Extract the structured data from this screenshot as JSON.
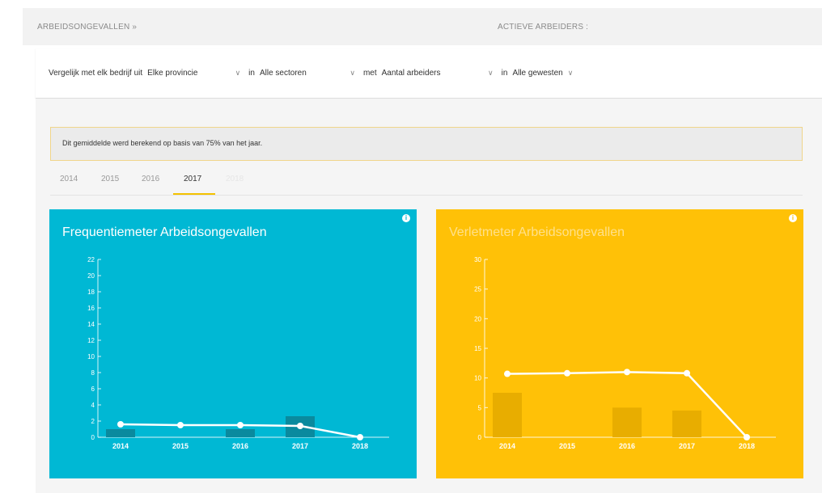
{
  "header": {
    "left_label": "ARBEIDSONGEVALLEN »",
    "right_label": "ACTIEVE ARBEIDERS :"
  },
  "filters": {
    "prefix": "Vergelijk met elk bedrijf uit",
    "province": "Elke provincie",
    "in1": "in",
    "sector": "Alle sectoren",
    "met": "met",
    "workers": "Aantal arbeiders",
    "in2": "in",
    "region": "Alle gewesten"
  },
  "notice": "Dit gemiddelde werd berekend op basis van 75% van het jaar.",
  "tabs": {
    "items": [
      "2014",
      "2015",
      "2016",
      "2017",
      "2018"
    ],
    "active": "2017"
  },
  "colors": {
    "frequency_bg": "#00b8d4",
    "severity_bg": "#ffc107",
    "tab_accent": "#f3c200"
  },
  "chart_data": [
    {
      "type": "line",
      "title": "Frequentiemeter Arbeidsongevallen",
      "categories": [
        "2014",
        "2015",
        "2016",
        "2017",
        "2018"
      ],
      "series": [
        {
          "type": "bar",
          "values": [
            1,
            0,
            1,
            2.6,
            0
          ]
        },
        {
          "type": "line",
          "values": [
            1.6,
            1.5,
            1.5,
            1.4,
            0
          ]
        }
      ],
      "ylim": [
        0,
        22
      ],
      "yticks": [
        0,
        2,
        4,
        6,
        8,
        10,
        12,
        14,
        16,
        18,
        20,
        22
      ]
    },
    {
      "type": "line",
      "title": "Verletmeter Arbeidsongevallen",
      "categories": [
        "2014",
        "2015",
        "2016",
        "2017",
        "2018"
      ],
      "series": [
        {
          "type": "bar",
          "values": [
            7.5,
            0,
            5,
            4.5,
            0
          ]
        },
        {
          "type": "line",
          "values": [
            10.7,
            10.8,
            11,
            10.8,
            0
          ]
        }
      ],
      "ylim": [
        0,
        30
      ],
      "yticks": [
        0,
        5,
        10,
        15,
        20,
        25,
        30
      ]
    }
  ]
}
